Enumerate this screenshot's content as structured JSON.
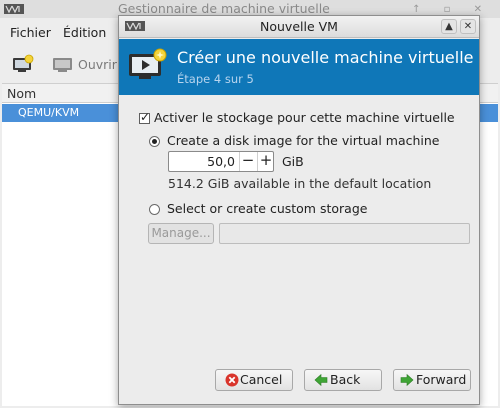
{
  "main_window": {
    "title": "Gestionnaire de machine virtuelle",
    "menu": [
      "Fichier",
      "Édition"
    ],
    "toolbar": {
      "open_label": "Ouvrir"
    },
    "list_header": "Nom",
    "connections": [
      {
        "label": "QEMU/KVM"
      }
    ]
  },
  "dialog": {
    "title": "Nouvelle VM",
    "header": {
      "title": "Créer une nouvelle machine virtuelle",
      "step": "Étape 4 sur 5"
    },
    "storage": {
      "enable_label": "Activer le stockage pour cette machine virtuelle",
      "enable_checked": true,
      "create_disk_label": "Create a disk image for the virtual machine",
      "create_disk_selected": true,
      "disk_size": "50,0",
      "disk_unit": "GiB",
      "available": "514.2 GiB available in the default location",
      "custom_label": "Select or create custom storage",
      "custom_selected": false,
      "manage_label": "Manage...",
      "custom_path": ""
    },
    "buttons": {
      "cancel": "Cancel",
      "back": "Back",
      "forward": "Forward"
    }
  },
  "colors": {
    "header_bg": "#0f77b8",
    "selection": "#4a90d9",
    "cancel_icon": "#d9342b",
    "nav_icon": "#3fa535"
  }
}
